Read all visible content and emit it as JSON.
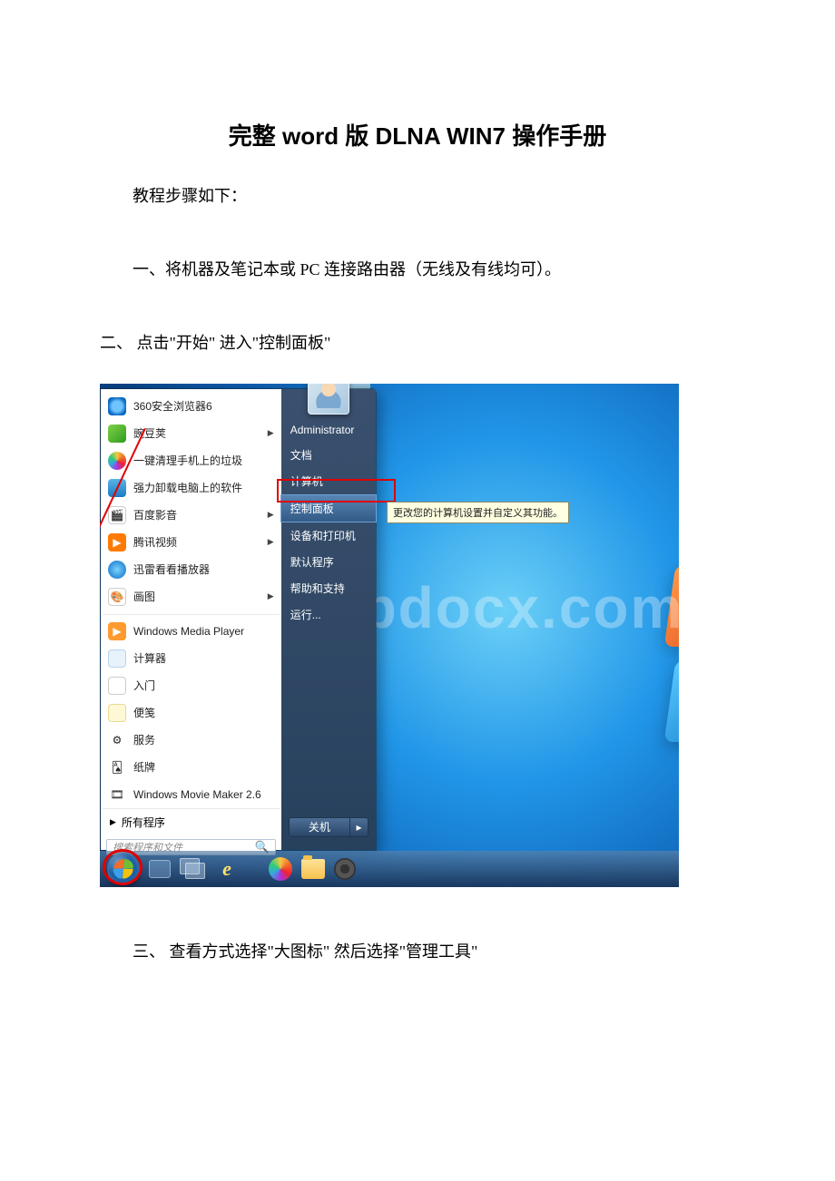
{
  "title": "完整 word 版 DLNA WIN7 操作手册",
  "intro": "教程步骤如下：",
  "step1": "一、将机器及笔记本或 PC 连接路由器（无线及有线均可）。",
  "step2": "二、 点击\"开始\" 进入\"控制面板\"",
  "step3": "三、 查看方式选择\"大图标\" 然后选择\"管理工具\"",
  "watermark": "www.bdocx.com",
  "start_menu": {
    "left_items": [
      {
        "label": "360安全浏览器6",
        "icon": "ie",
        "arrow": false
      },
      {
        "label": "豌豆荚",
        "icon": "pea",
        "arrow": true
      },
      {
        "label": "一键清理手机上的垃圾",
        "icon": "clean",
        "arrow": false
      },
      {
        "label": "强力卸载电脑上的软件",
        "icon": "uninst",
        "arrow": false
      },
      {
        "label": "百度影音",
        "icon": "baidu",
        "arrow": true
      },
      {
        "label": "腾讯视频",
        "icon": "tx",
        "arrow": true
      },
      {
        "label": "迅雷看看播放器",
        "icon": "xl",
        "arrow": false
      },
      {
        "label": "画图",
        "icon": "paint",
        "arrow": true
      },
      {
        "label": "Windows Media Player",
        "icon": "wmp",
        "arrow": false
      },
      {
        "label": "计算器",
        "icon": "calc",
        "arrow": false
      },
      {
        "label": "入门",
        "icon": "rm",
        "arrow": false
      },
      {
        "label": "便笺",
        "icon": "note",
        "arrow": false
      },
      {
        "label": "服务",
        "icon": "serv",
        "arrow": false
      },
      {
        "label": "纸牌",
        "icon": "sol",
        "arrow": false
      },
      {
        "label": "Windows Movie Maker 2.6",
        "icon": "wmm",
        "arrow": false
      }
    ],
    "all_programs": "所有程序",
    "search_placeholder": "搜索程序和文件",
    "right_items": [
      {
        "label": "Administrator"
      },
      {
        "label": "文档"
      },
      {
        "label": "计算机"
      },
      {
        "label": "控制面板",
        "highlight": true
      },
      {
        "label": "设备和打印机"
      },
      {
        "label": "默认程序"
      },
      {
        "label": "帮助和支持"
      },
      {
        "label": "运行..."
      }
    ],
    "shutdown": "关机",
    "tooltip": "更改您的计算机设置并自定义其功能。"
  }
}
